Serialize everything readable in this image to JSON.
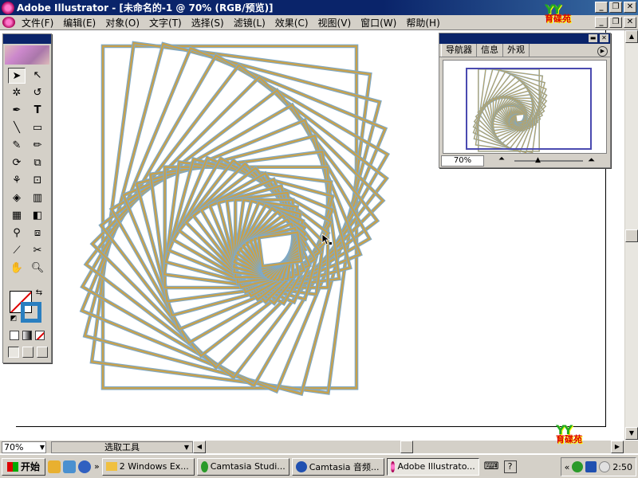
{
  "window": {
    "title": "Adobe Illustrator - [未命名的-1 @ 70% (RGB/预览)]"
  },
  "menu": {
    "items": [
      "文件(F)",
      "编辑(E)",
      "对象(O)",
      "文字(T)",
      "选择(S)",
      "滤镜(L)",
      "效果(C)",
      "视图(V)",
      "窗口(W)",
      "帮助(H)"
    ]
  },
  "logo": {
    "yy": "YY",
    "text": "育碟苑"
  },
  "status": {
    "zoom": "70%",
    "tool": "选取工具"
  },
  "navigator": {
    "tabs": [
      "导航器",
      "信息",
      "外观"
    ],
    "zoom": "70%"
  },
  "taskbar": {
    "start": "开始",
    "tasks": [
      "2 Windows Ex...",
      "Camtasia Studi...",
      "Camtasia 音频...",
      "Adobe Illustrato..."
    ],
    "clock": "2:50"
  },
  "colors": {
    "stroke_outer": "#7fa9c6",
    "stroke_inner": "#c9a14a",
    "title": "#0a246a"
  }
}
